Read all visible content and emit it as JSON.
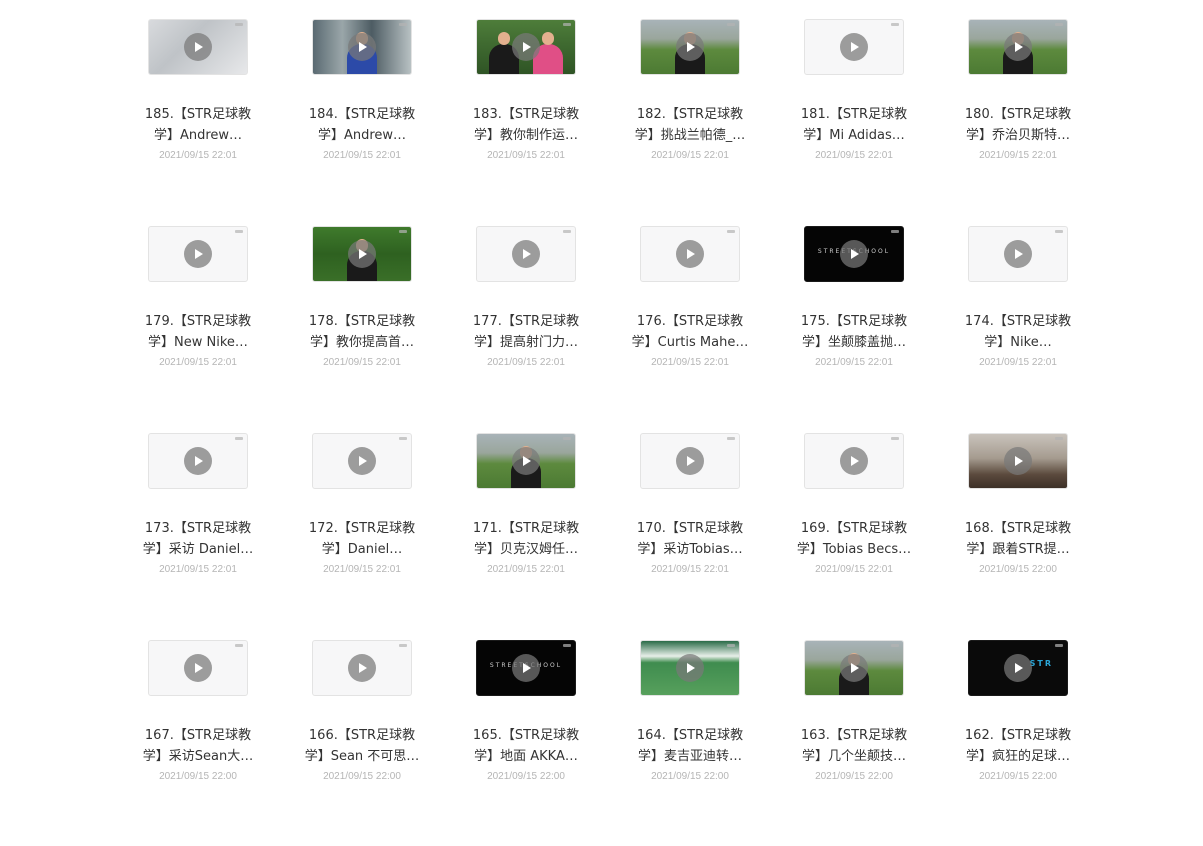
{
  "videos": [
    {
      "l1": "185.【STR足球教",
      "l2": "学】Andrew…",
      "date": "2021/09/15 22:01",
      "thumb": "t-gray"
    },
    {
      "l1": "184.【STR足球教",
      "l2": "学】Andrew…",
      "date": "2021/09/15 22:01",
      "thumb": "t-station"
    },
    {
      "l1": "183.【STR足球教",
      "l2": "学】教你制作运…",
      "date": "2021/09/15 22:01",
      "thumb": "t-green"
    },
    {
      "l1": "182.【STR足球教",
      "l2": "学】挑战兰帕德_…",
      "date": "2021/09/15 22:01",
      "thumb": "t-field"
    },
    {
      "l1": "181.【STR足球教",
      "l2": "学】Mi Adidas…",
      "date": "2021/09/15 22:01",
      "thumb": "t-blank"
    },
    {
      "l1": "180.【STR足球教",
      "l2": "学】乔治贝斯特…",
      "date": "2021/09/15 22:01",
      "thumb": "t-field"
    },
    {
      "l1": "179.【STR足球教",
      "l2": "学】New Nike…",
      "date": "2021/09/15 22:01",
      "thumb": "t-blank"
    },
    {
      "l1": "178.【STR足球教",
      "l2": "学】教你提高首…",
      "date": "2021/09/15 22:01",
      "thumb": "t-bush"
    },
    {
      "l1": "177.【STR足球教",
      "l2": "学】提高射门力…",
      "date": "2021/09/15 22:01",
      "thumb": "t-blank"
    },
    {
      "l1": "176.【STR足球教",
      "l2": "学】Curtis Mahe…",
      "date": "2021/09/15 22:01",
      "thumb": "t-blank"
    },
    {
      "l1": "175.【STR足球教",
      "l2": "学】坐颠膝盖抛…",
      "date": "2021/09/15 22:01",
      "thumb": "t-dark"
    },
    {
      "l1": "174.【STR足球教",
      "l2": "学】Nike…",
      "date": "2021/09/15 22:01",
      "thumb": "t-blank"
    },
    {
      "l1": "173.【STR足球教",
      "l2": "学】采访 Daniel…",
      "date": "2021/09/15 22:01",
      "thumb": "t-blank"
    },
    {
      "l1": "172.【STR足球教",
      "l2": "学】Daniel…",
      "date": "2021/09/15 22:01",
      "thumb": "t-blank"
    },
    {
      "l1": "171.【STR足球教",
      "l2": "学】贝克汉姆任…",
      "date": "2021/09/15 22:01",
      "thumb": "t-field"
    },
    {
      "l1": "170.【STR足球教",
      "l2": "学】采访Tobias…",
      "date": "2021/09/15 22:01",
      "thumb": "t-blank"
    },
    {
      "l1": "169.【STR足球教",
      "l2": "学】Tobias Becs…",
      "date": "2021/09/15 22:01",
      "thumb": "t-blank"
    },
    {
      "l1": "168.【STR足球教",
      "l2": "学】跟着STR提…",
      "date": "2021/09/15 22:00",
      "thumb": "t-room"
    },
    {
      "l1": "167.【STR足球教",
      "l2": "学】采访Sean大…",
      "date": "2021/09/15 22:00",
      "thumb": "t-blank"
    },
    {
      "l1": "166.【STR足球教",
      "l2": "学】Sean 不可思…",
      "date": "2021/09/15 22:00",
      "thumb": "t-blank"
    },
    {
      "l1": "165.【STR足球教",
      "l2": "学】地面 AKKA…",
      "date": "2021/09/15 22:00",
      "thumb": "t-dark"
    },
    {
      "l1": "164.【STR足球教",
      "l2": "学】麦吉亚迪转…",
      "date": "2021/09/15 22:00",
      "thumb": "t-stadium"
    },
    {
      "l1": "163.【STR足球教",
      "l2": "学】几个坐颠技…",
      "date": "2021/09/15 22:00",
      "thumb": "t-field"
    },
    {
      "l1": "162.【STR足球教",
      "l2": "学】疯狂的足球…",
      "date": "2021/09/15 22:00",
      "thumb": "t-logo"
    }
  ],
  "thumb_texts": {
    "street_school": "STREETSCHOOL",
    "str_logo": "STR"
  }
}
